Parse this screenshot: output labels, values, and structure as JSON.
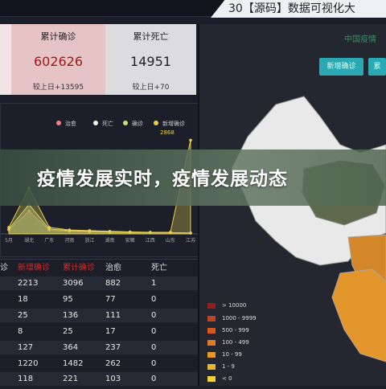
{
  "header": {
    "title": "30【源码】数据可视化大"
  },
  "cards": [
    {
      "label": "累计确诊",
      "value": "602626",
      "compare": "较上日+13595"
    },
    {
      "label": "累计死亡",
      "value": "14951",
      "compare": "较上日+70"
    }
  ],
  "chart": {
    "legend": [
      "治愈",
      "死亡",
      "确诊",
      "新增确诊"
    ],
    "peak_label": "2868",
    "x_labels": [
      "5月",
      "湖北",
      "广东",
      "河南",
      "浙江",
      "湖南",
      "安徽",
      "江西",
      "山东",
      "江苏"
    ]
  },
  "chart_data": {
    "type": "area",
    "categories": [
      "5月",
      "湖北",
      "广东",
      "河南",
      "浙江",
      "湖南",
      "安徽",
      "江西",
      "山东",
      "江苏"
    ],
    "series": [
      {
        "name": "治愈",
        "values": [
          120,
          700,
          120,
          80,
          60,
          50,
          40,
          30,
          30,
          20
        ]
      },
      {
        "name": "确诊",
        "values": [
          150,
          900,
          150,
          100,
          80,
          60,
          50,
          40,
          40,
          30
        ]
      },
      {
        "name": "新增确诊",
        "values": [
          200,
          1400,
          200,
          120,
          100,
          80,
          60,
          50,
          50,
          2868
        ]
      }
    ],
    "ylim": [
      0,
      3000
    ]
  },
  "map": {
    "title": "中国疫情",
    "buttons": [
      "新增确诊",
      "累"
    ],
    "legend": [
      {
        "label": "> 10000",
        "color": "#9b1c1c"
      },
      {
        "label": "1000 - 9999",
        "color": "#c0431f"
      },
      {
        "label": "500 - 999",
        "color": "#d45a22"
      },
      {
        "label": "100 - 499",
        "color": "#e07a23"
      },
      {
        "label": "10 - 99",
        "color": "#e39a2a"
      },
      {
        "label": "1 - 9",
        "color": "#e8b82e"
      },
      {
        "label": "< 0",
        "color": "#efd23a"
      }
    ]
  },
  "table": {
    "headers": [
      "诊",
      "新增确诊",
      "累计确诊",
      "治愈",
      "死亡"
    ],
    "rows": [
      [
        "",
        "2213",
        "3096",
        "882",
        "1"
      ],
      [
        "",
        "18",
        "95",
        "77",
        "0"
      ],
      [
        "",
        "25",
        "136",
        "111",
        "0"
      ],
      [
        "",
        "8",
        "25",
        "17",
        "0"
      ],
      [
        "",
        "127",
        "364",
        "237",
        "0"
      ],
      [
        "",
        "1220",
        "1482",
        "262",
        "0"
      ],
      [
        "",
        "118",
        "221",
        "103",
        "0"
      ]
    ]
  },
  "banner": {
    "text": "疫情发展实时，疫情发展动态"
  },
  "colors": {
    "accent": "#2aa8b4",
    "confirmed": "#9b1b1b"
  }
}
